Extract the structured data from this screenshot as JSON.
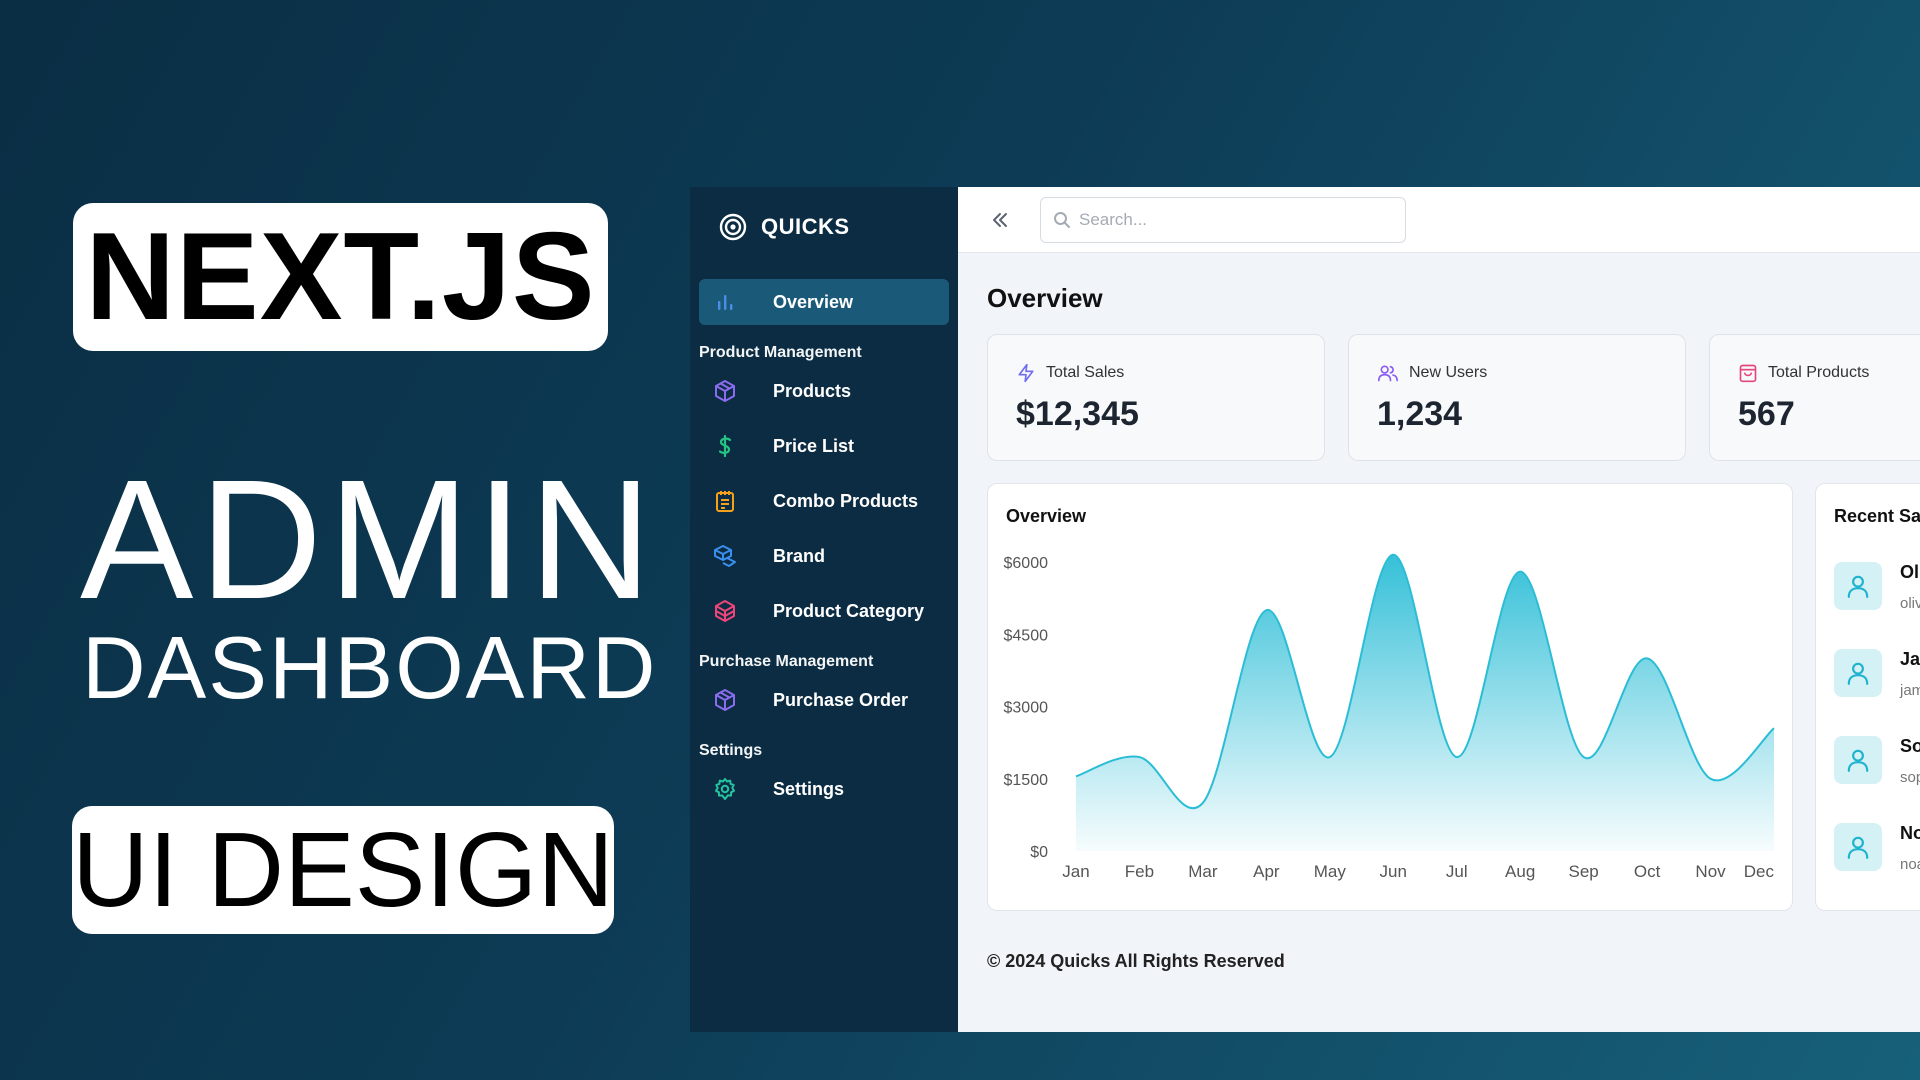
{
  "promo": {
    "framework": "NEXT.JS",
    "line1": "ADMIN",
    "line2": "DASHBOARD",
    "line3": "UI DESIGN"
  },
  "app": {
    "brand": "QUICKS"
  },
  "sidebar": {
    "overview": {
      "label": "Overview",
      "icon": "bar-chart-icon"
    },
    "sections": [
      {
        "title": "Product Management",
        "items": [
          {
            "label": "Products",
            "icon": "box-icon",
            "color": "#8b6cf0"
          },
          {
            "label": "Price List",
            "icon": "dollar-icon",
            "color": "#25c483"
          },
          {
            "label": "Combo Products",
            "icon": "clipboard-icon",
            "color": "#f4a21c"
          },
          {
            "label": "Brand",
            "icon": "boxes-icon",
            "color": "#3b8ff0"
          },
          {
            "label": "Product Category",
            "icon": "package-icon",
            "color": "#f0457a"
          }
        ]
      },
      {
        "title": "Purchase Management",
        "items": [
          {
            "label": "Purchase Order",
            "icon": "box-icon",
            "color": "#8b6cf0"
          }
        ]
      },
      {
        "title": "Settings",
        "items": [
          {
            "label": "Settings",
            "icon": "gear-icon",
            "color": "#25c4a0"
          }
        ]
      }
    ]
  },
  "topbar": {
    "search_placeholder": "Search..."
  },
  "main": {
    "title": "Overview",
    "stats": [
      {
        "label": "Total Sales",
        "value": "$12,345",
        "icon": "lightning-icon",
        "color": "#6f6ef0"
      },
      {
        "label": "New Users",
        "value": "1,234",
        "icon": "users-icon",
        "color": "#8b5cf6"
      },
      {
        "label": "Total Products",
        "value": "567",
        "icon": "shopping-bag-icon",
        "color": "#e5477a"
      }
    ],
    "chart_title": "Overview",
    "recent_title": "Recent Sale",
    "recent_sales": [
      {
        "name": "Oli",
        "email": "oliv"
      },
      {
        "name": "Jan",
        "email": "jam"
      },
      {
        "name": "Sop",
        "email": "sop"
      },
      {
        "name": "No",
        "email": "noa"
      }
    ],
    "footer": "© 2024 Quicks All Rights Reserved"
  },
  "colors": {
    "accent": "#2bbdd6",
    "sidebar_bg": "#0b2c42",
    "active_bg": "#1a5a78"
  },
  "chart_data": {
    "type": "area",
    "title": "Overview",
    "categories": [
      "Jan",
      "Feb",
      "Mar",
      "Apr",
      "May",
      "Jun",
      "Jul",
      "Aug",
      "Sep",
      "Oct",
      "Nov",
      "Dec"
    ],
    "series": [
      {
        "values": [
          1550,
          1950,
          1000,
          5000,
          1950,
          6150,
          1950,
          5800,
          1950,
          4000,
          1500,
          2550
        ]
      }
    ],
    "y_ticks": [
      "$0",
      "$1500",
      "$3000",
      "$4500",
      "$6000"
    ],
    "ylim": [
      0,
      6000
    ],
    "grid": false
  }
}
